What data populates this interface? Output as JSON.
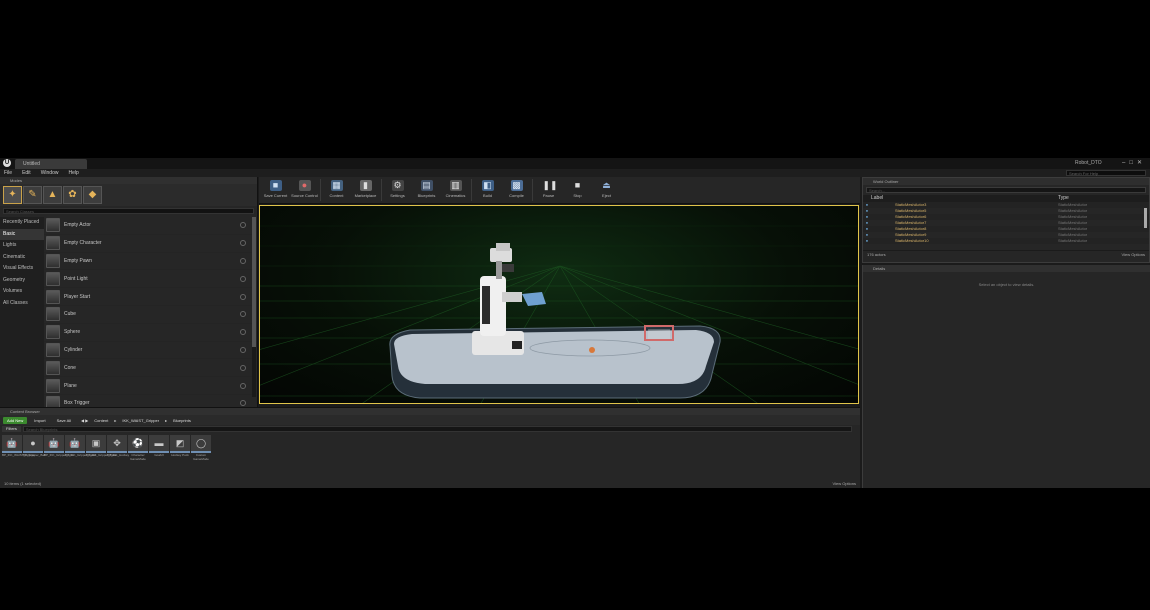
{
  "app": {
    "tab_title": "Untitled",
    "project_name": "Robot_DTO",
    "menu": [
      "File",
      "Edit",
      "Window",
      "Help"
    ],
    "search_help_placeholder": "Search For Help"
  },
  "modes": {
    "tab_label": "Modes",
    "search_placeholder": "Search Classes",
    "categories": [
      "Recently Placed",
      "Basic",
      "Lights",
      "Cinematic",
      "Visual Effects",
      "Geometry",
      "Volumes",
      "All Classes"
    ],
    "selected_category": "Basic",
    "items": [
      "Empty Actor",
      "Empty Character",
      "Empty Pawn",
      "Point Light",
      "Player Start",
      "Cube",
      "Sphere",
      "Cylinder",
      "Cone",
      "Plane",
      "Box Trigger"
    ]
  },
  "toolbar": {
    "buttons": [
      {
        "label": "Save Current",
        "icon": "save-icon",
        "color": "#7aa9d8"
      },
      {
        "label": "Source Control",
        "icon": "source-control-icon",
        "color": "#b0b0b0"
      },
      {
        "label": "Content",
        "icon": "content-icon",
        "color": "#9fb8d8"
      },
      {
        "label": "Marketplace",
        "icon": "marketplace-icon",
        "color": "#c9c9c9"
      },
      {
        "label": "Settings",
        "icon": "settings-icon",
        "color": "#bdbdbd"
      },
      {
        "label": "Blueprints",
        "icon": "blueprints-icon",
        "color": "#8aa7c9"
      },
      {
        "label": "Cinematics",
        "icon": "cinematics-icon",
        "color": "#c9c9c9"
      },
      {
        "label": "Build",
        "icon": "build-icon",
        "color": "#8fb0d8"
      },
      {
        "label": "Compile",
        "icon": "compile-icon",
        "color": "#8fb0d8"
      },
      {
        "label": "Pause",
        "icon": "pause-icon",
        "color": "#cfcfcf"
      },
      {
        "label": "Stop",
        "icon": "stop-icon",
        "color": "#cfcfcf"
      },
      {
        "label": "Eject",
        "icon": "eject-icon",
        "color": "#cfcfcf"
      }
    ]
  },
  "outliner": {
    "tab_label": "World Outliner",
    "search_placeholder": "Search...",
    "col_label": "Label",
    "col_type": "Type",
    "rows": [
      {
        "label": "StaticMeshActor3",
        "type": "StaticMeshActor"
      },
      {
        "label": "StaticMeshActor5",
        "type": "StaticMeshActor"
      },
      {
        "label": "StaticMeshActor6",
        "type": "StaticMeshActor"
      },
      {
        "label": "StaticMeshActor7",
        "type": "StaticMeshActor"
      },
      {
        "label": "StaticMeshActor8",
        "type": "StaticMeshActor"
      },
      {
        "label": "StaticMeshActor9",
        "type": "StaticMeshActor"
      },
      {
        "label": "StaticMeshActor10",
        "type": "StaticMeshActor"
      }
    ],
    "actor_count": "176 actors",
    "view_options": "View Options"
  },
  "details": {
    "tab_label": "Details",
    "empty_message": "Select an object to view details."
  },
  "content_browser": {
    "tab_label": "Content Browser",
    "add_new": "Add New",
    "import": "Import",
    "save_all": "Save All",
    "path": [
      "Content",
      "IKK_WAIST_Gripper",
      "Blueprints"
    ],
    "filters": "Filters",
    "search_placeholder": "Search Blueprints",
    "assets": [
      {
        "name": "BP_IKK_WAIST_Gripper",
        "icon": "robot-icon"
      },
      {
        "name": "BP_Gripper_Ball",
        "icon": "ball-icon"
      },
      {
        "name": "BP_IKK_Gripper_Arm",
        "icon": "robot-icon"
      },
      {
        "name": "BP_IKK_Gripper_Head",
        "icon": "robot-icon"
      },
      {
        "name": "BP_IKK_Gripper_Base",
        "icon": "robot-icon"
      },
      {
        "name": "BP_IKK_Hockey",
        "icon": "hockey-icon"
      },
      {
        "name": "Character GameMode",
        "icon": "soccer-icon"
      },
      {
        "name": "GoalUI",
        "icon": "ui-icon"
      },
      {
        "name": "Hockey Puck",
        "icon": "puck-icon"
      },
      {
        "name": "Custom GameMode",
        "icon": "sphere-icon"
      }
    ],
    "item_count": "10 items (1 selected)",
    "view_options": "View Options"
  }
}
